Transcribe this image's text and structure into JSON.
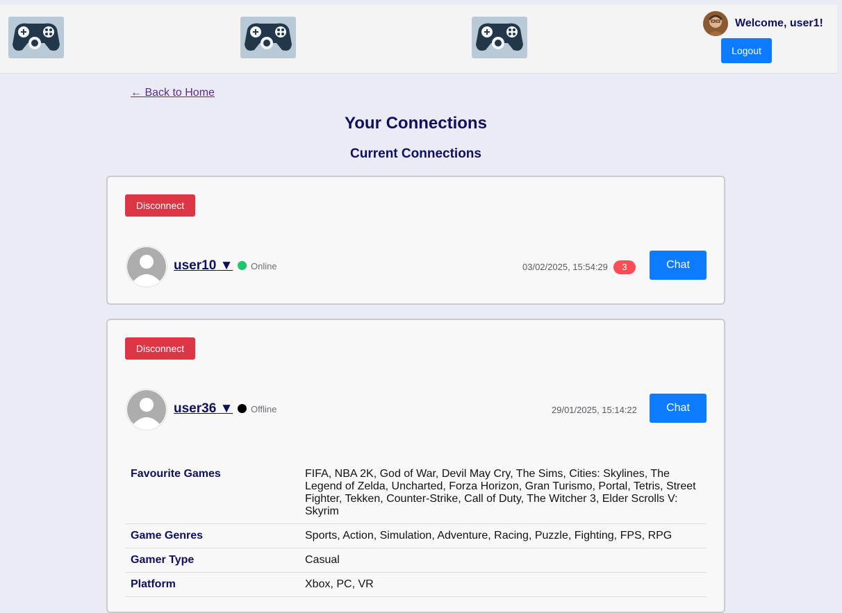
{
  "header": {
    "logos": [
      "gamepad-logo",
      "gamepad-logo",
      "gamepad-logo"
    ],
    "welcome_text": "Welcome, user1!",
    "logout_label": "Logout"
  },
  "nav": {
    "back_link": "← Back to Home"
  },
  "page": {
    "title": "Your Connections",
    "section_title": "Current Connections"
  },
  "connections": [
    {
      "disconnect_label": "Disconnect",
      "username": "user10",
      "dropdown_glyph": "▼",
      "status": "Online",
      "status_color": "#1ec76b",
      "timestamp": "03/02/2025, 15:54:29",
      "unread_count": "3",
      "chat_label": "Chat"
    },
    {
      "disconnect_label": "Disconnect",
      "username": "user36",
      "dropdown_glyph": "▼",
      "status": "Offline",
      "status_color": "#000000",
      "timestamp": "29/01/2025, 15:14:22",
      "chat_label": "Chat",
      "details": [
        {
          "label": "Favourite Games",
          "value": "FIFA, NBA 2K, God of War, Devil May Cry, The Sims, Cities: Skylines, The Legend of Zelda, Uncharted, Forza Horizon, Gran Turismo, Portal, Tetris, Street Fighter, Tekken, Counter-Strike, Call of Duty, The Witcher 3, Elder Scrolls V: Skyrim"
        },
        {
          "label": "Game Genres",
          "value": "Sports, Action, Simulation, Adventure, Racing, Puzzle, Fighting, FPS, RPG"
        },
        {
          "label": "Gamer Type",
          "value": "Casual"
        },
        {
          "label": "Platform",
          "value": "Xbox, PC, VR"
        }
      ]
    }
  ],
  "colors": {
    "accent": "#0d7bff",
    "danger": "#dc3545",
    "heading": "#0f0f5c",
    "background": "#ebebf6"
  }
}
